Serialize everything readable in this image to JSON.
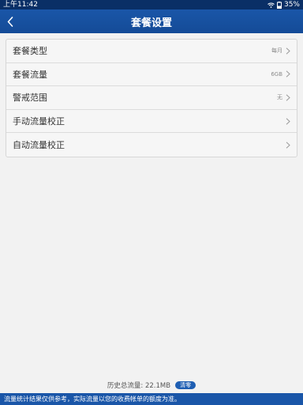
{
  "status_bar": {
    "time": "上午11:42",
    "battery": "35%"
  },
  "header": {
    "title": "套餐设置"
  },
  "settings": {
    "items": [
      {
        "label": "套餐类型",
        "value": "每月"
      },
      {
        "label": "套餐流量",
        "value": "6GB"
      },
      {
        "label": "警戒范围",
        "value": "无"
      },
      {
        "label": "手动流量校正",
        "value": ""
      },
      {
        "label": "自动流量校正",
        "value": ""
      }
    ]
  },
  "footer": {
    "total_text": "历史总流量: 22.1MB",
    "clear_label": "清零",
    "disclaimer": "流量统计结果仅供参考，实际流量以您的收费帐单的额度为准。"
  },
  "colors": {
    "header_bg": "#1a56a8",
    "status_bg": "#0a2f66",
    "accent": "#1f5fb3"
  },
  "icons": {
    "back": "chevron-left-icon",
    "row_arrow": "chevron-right-icon",
    "wifi": "wifi-icon",
    "battery": "battery-icon"
  }
}
